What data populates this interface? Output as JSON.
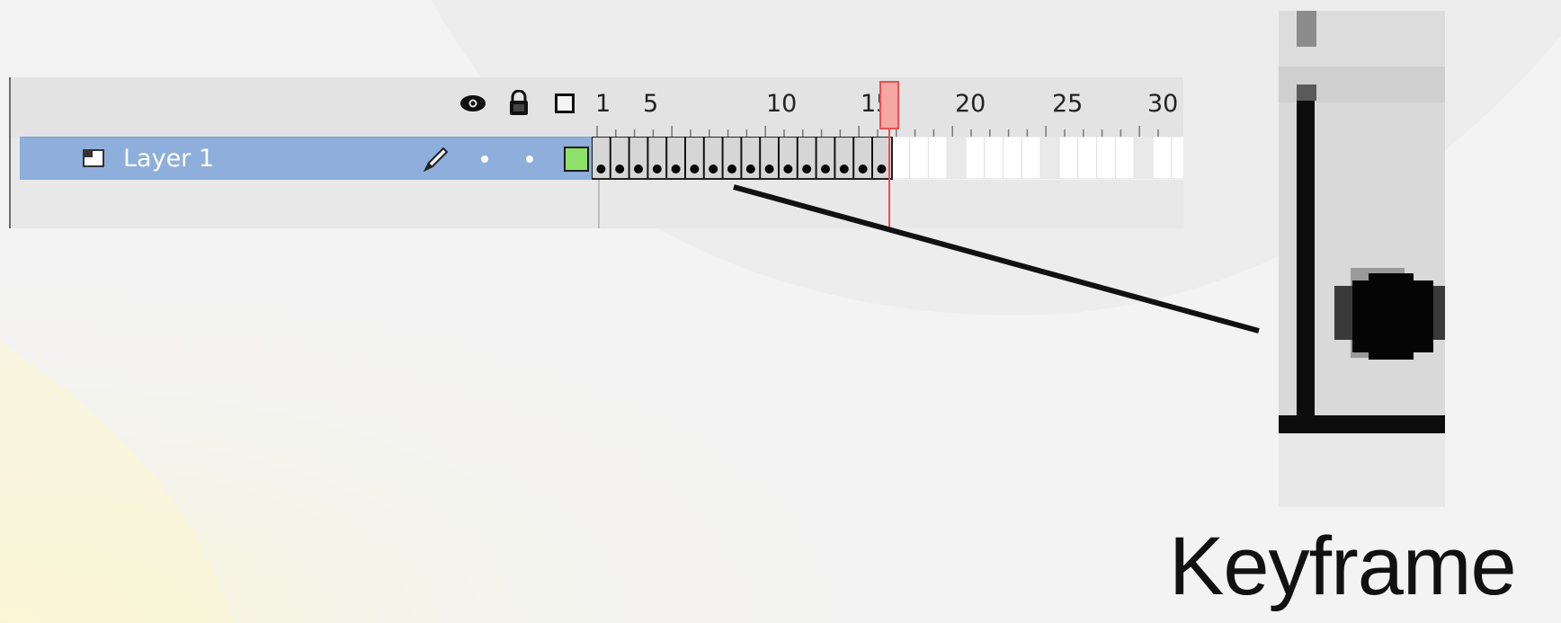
{
  "timeline": {
    "header_icons": [
      "eye-icon",
      "lock-icon",
      "outline-icon"
    ],
    "ruler_labels": [
      "1",
      "5",
      "10",
      "15",
      "20",
      "25",
      "30"
    ],
    "playhead_frame": 16,
    "layer": {
      "name": "Layer 1",
      "icon": "layer-icon",
      "edit_icon": "pencil-icon",
      "color": "#8fe06a",
      "keyframe_count": 16
    },
    "colors": {
      "layer_row": "#8eaedb",
      "playhead": "#e8504f",
      "swatch": "#8fe06a"
    }
  },
  "zoom_panel": {
    "icon": "keyframe-dot-icon"
  },
  "caption": "Keyframe"
}
